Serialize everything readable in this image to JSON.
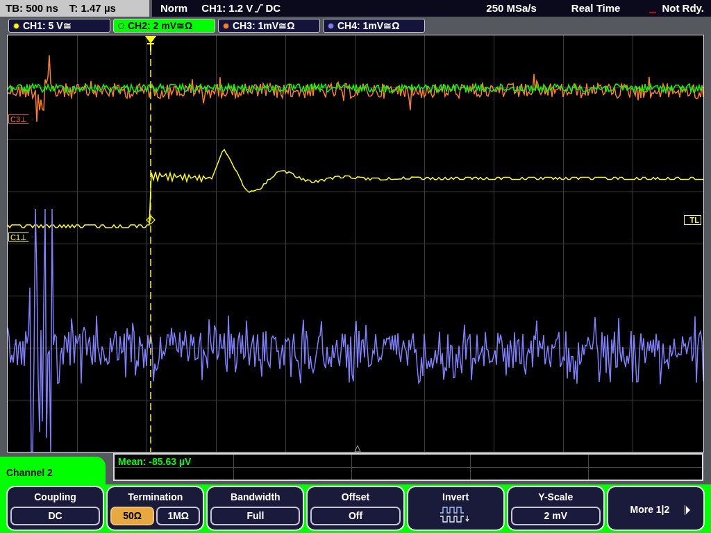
{
  "status_bar": {
    "timebase": "TB: 500 ns",
    "trigger_time": "T: 1.47 µs",
    "trigger_mode": "Norm",
    "trigger_level": "CH1: 1.2 V",
    "trigger_coupling": "DC",
    "sample_rate": "250 MSa/s",
    "acquisition": "Real Time",
    "state": "Not Rdy."
  },
  "channels": [
    {
      "label": "CH1: 5 V≅",
      "color": "#ffff00",
      "selected": false
    },
    {
      "label": "CH2: 2 mV≅Ω",
      "color": "#00ff00",
      "selected": true
    },
    {
      "label": "CH3: 1mV≅Ω",
      "color": "#ff7f27",
      "selected": false
    },
    {
      "label": "CH4: 1mV≅Ω",
      "color": "#8080ff",
      "selected": false
    }
  ],
  "markers": [
    {
      "label": "C3⊥",
      "color": "#ff7f27"
    },
    {
      "label": "C1⊥",
      "color": "#ffff00"
    }
  ],
  "trigger_level_marker": "TL",
  "measurement": "Mean: -85.63 µV",
  "menu": {
    "title": "Channel 2",
    "softkeys": [
      {
        "kind": "value",
        "title": "Coupling",
        "value": "DC"
      },
      {
        "kind": "options",
        "title": "Termination",
        "options": [
          {
            "label": "50Ω",
            "selected": true
          },
          {
            "label": "1MΩ",
            "selected": false
          }
        ]
      },
      {
        "kind": "value",
        "title": "Bandwidth",
        "value": "Full"
      },
      {
        "kind": "value",
        "title": "Offset",
        "value": "Off"
      },
      {
        "kind": "icon",
        "title": "Invert"
      },
      {
        "kind": "value",
        "title": "Y-Scale",
        "value": "2 mV"
      },
      {
        "kind": "more",
        "label": "More 1|2"
      }
    ]
  }
}
